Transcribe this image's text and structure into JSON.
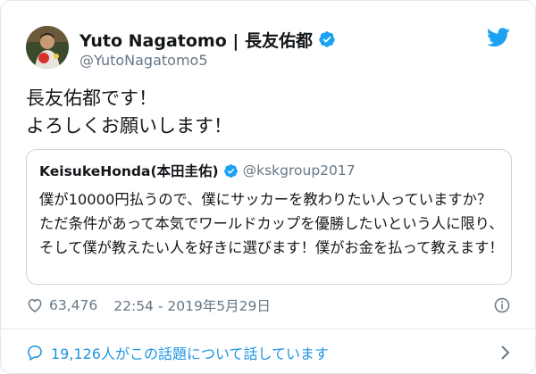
{
  "author": {
    "display_name": "Yuto Nagatomo | 長友佑都",
    "handle": "@YutoNagatomo5"
  },
  "tweet": {
    "line1": "長友佑都です！",
    "line2": "よろしくお願いします！"
  },
  "quote": {
    "display_name": "KeisukeHonda(本田圭佑)",
    "handle": "@kskgroup2017",
    "line1": "僕が10000円払うので、僕にサッカーを教わりたい人っていますか？ただ条件があって本気でワールドカップを優勝したいという人に限り、そして僕が教えたい人を好きに選びます！僕がお金を払って教えます！"
  },
  "meta": {
    "likes": "63,476",
    "timestamp": "22:54 - 2019年5月29日"
  },
  "footer": {
    "conversation": "19,126人がこの話題について話しています"
  },
  "colors": {
    "accent": "#1da1f2",
    "link": "#1b95e0",
    "secondary": "#657786"
  }
}
